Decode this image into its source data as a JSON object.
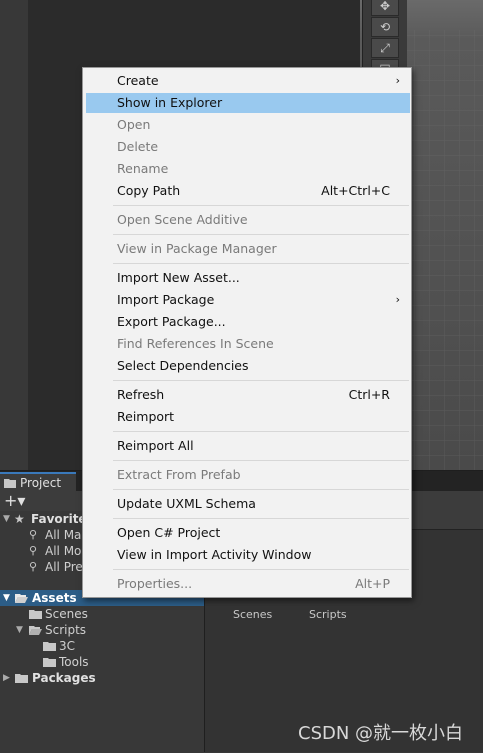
{
  "scene_tools": [
    "✥",
    "⟲",
    "⤢",
    "▭"
  ],
  "project_tab": {
    "label": "Project"
  },
  "toolbar": {
    "plus": "+▾"
  },
  "tree": [
    {
      "label": "Favorites",
      "icon": "★",
      "fold": "▼"
    },
    {
      "label": "All Ma",
      "icon": "⚲"
    },
    {
      "label": "All Mo",
      "icon": "⚲"
    },
    {
      "label": "All Pre",
      "icon": "⚲"
    },
    {
      "label": "Assets",
      "icon": "folder-open",
      "fold": "▼"
    },
    {
      "label": "Scenes",
      "icon": "folder"
    },
    {
      "label": "Scripts",
      "icon": "folder-open",
      "fold": "▼"
    },
    {
      "label": "3C",
      "icon": "folder"
    },
    {
      "label": "Tools",
      "icon": "folder"
    },
    {
      "label": "Packages",
      "icon": "folder",
      "fold": "▶"
    }
  ],
  "grid": {
    "items": [
      "Scenes",
      "Scripts"
    ]
  },
  "menu": {
    "items": [
      {
        "label": "Create",
        "submenu": true
      },
      {
        "label": "Show in Explorer",
        "highlighted": true
      },
      {
        "label": "Open",
        "disabled": true
      },
      {
        "label": "Delete",
        "disabled": true
      },
      {
        "label": "Rename",
        "disabled": true
      },
      {
        "label": "Copy Path",
        "shortcut": "Alt+Ctrl+C"
      },
      {
        "label": "Open Scene Additive",
        "disabled": true
      },
      {
        "label": "View in Package Manager",
        "disabled": true
      },
      {
        "label": "Import New Asset..."
      },
      {
        "label": "Import Package",
        "submenu": true
      },
      {
        "label": "Export Package..."
      },
      {
        "label": "Find References In Scene",
        "disabled": true
      },
      {
        "label": "Select Dependencies"
      },
      {
        "label": "Refresh",
        "shortcut": "Ctrl+R"
      },
      {
        "label": "Reimport"
      },
      {
        "label": "Reimport All"
      },
      {
        "label": "Extract From Prefab",
        "disabled": true
      },
      {
        "label": "Update UXML Schema"
      },
      {
        "label": "Open C# Project"
      },
      {
        "label": "View in Import Activity Window"
      },
      {
        "label": "Properties...",
        "shortcut": "Alt+P",
        "disabled": true
      }
    ],
    "arrow": "›"
  },
  "watermark": "CSDN @就一枚小白",
  "colors": {
    "menu_highlight": "#99c9ef",
    "selection": "#2c5d87",
    "tab_accent": "#3a79bb"
  }
}
